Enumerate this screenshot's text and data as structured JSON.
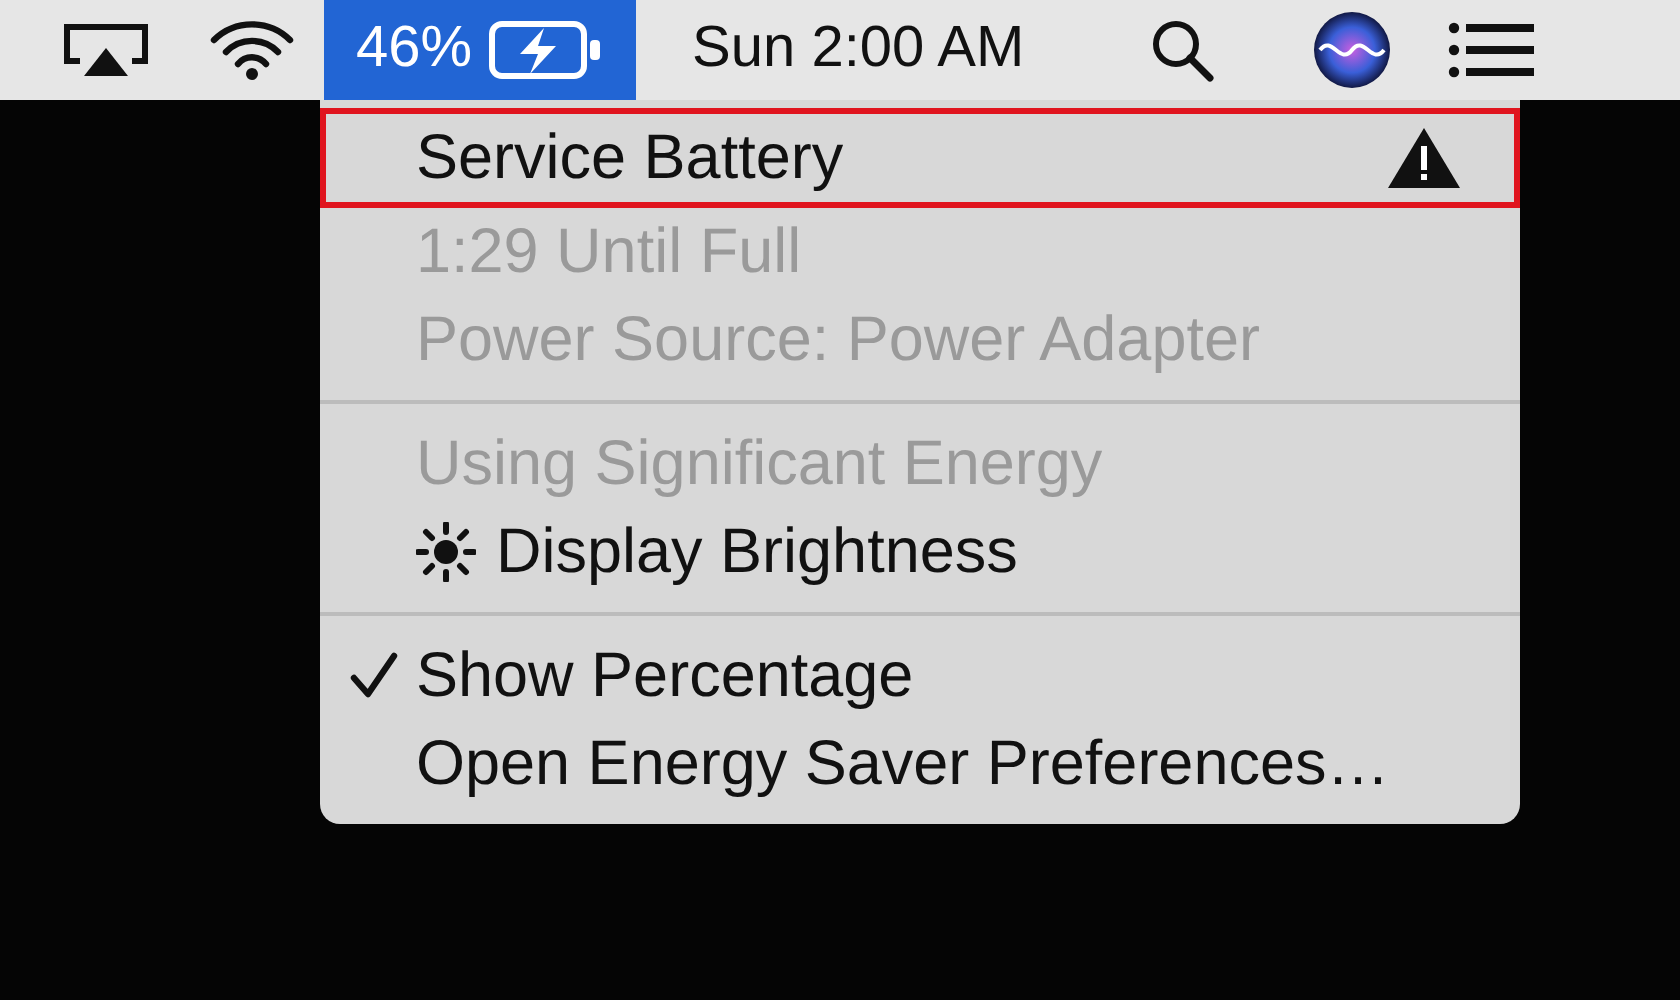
{
  "menu_bar": {
    "items": [
      {
        "kind": "airplay",
        "selected": false
      },
      {
        "kind": "wifi",
        "selected": false
      },
      {
        "kind": "battery",
        "text": "46%",
        "selected": true
      },
      {
        "kind": "clock",
        "text": "Sun 2:00 AM",
        "selected": false
      },
      {
        "kind": "search",
        "selected": false
      },
      {
        "kind": "siri",
        "selected": false
      },
      {
        "kind": "list",
        "selected": false
      }
    ]
  },
  "menu": {
    "sections": [
      [
        {
          "label": "Service Battery",
          "enabled": true,
          "highlighted": true,
          "warning": true,
          "checked": false
        },
        {
          "label": "1:29 Until Full",
          "enabled": false,
          "highlighted": false,
          "warning": false,
          "checked": false
        },
        {
          "label": "Power Source: Power Adapter",
          "enabled": false,
          "highlighted": false,
          "warning": false,
          "checked": false
        }
      ],
      [
        {
          "label": "Using Significant Energy",
          "enabled": false,
          "highlighted": false,
          "warning": false,
          "checked": false
        },
        {
          "label": "Display Brightness",
          "enabled": true,
          "highlighted": false,
          "warning": false,
          "checked": false,
          "kind": "with-sun"
        }
      ],
      [
        {
          "label": "Show Percentage",
          "enabled": true,
          "highlighted": false,
          "warning": false,
          "checked": true
        },
        {
          "label": "Open Energy Saver Preferences…",
          "enabled": true,
          "highlighted": false,
          "warning": false,
          "checked": false
        }
      ]
    ]
  }
}
